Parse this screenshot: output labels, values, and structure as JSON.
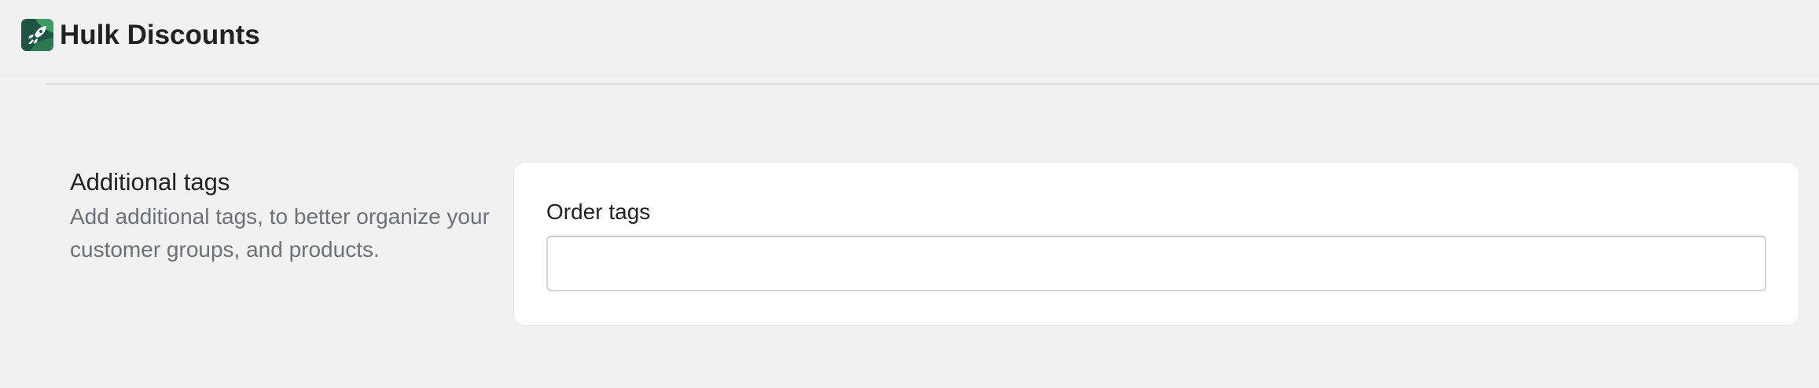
{
  "header": {
    "app_title": "Hulk Discounts",
    "logo_icon": "rocket-leaf-icon",
    "logo_color": "#1f5445"
  },
  "section": {
    "title": "Additional tags",
    "description": "Add additional tags, to better organize your customer groups, and products."
  },
  "card": {
    "order_tags_label": "Order tags",
    "order_tags_value": "",
    "order_tags_placeholder": ""
  }
}
